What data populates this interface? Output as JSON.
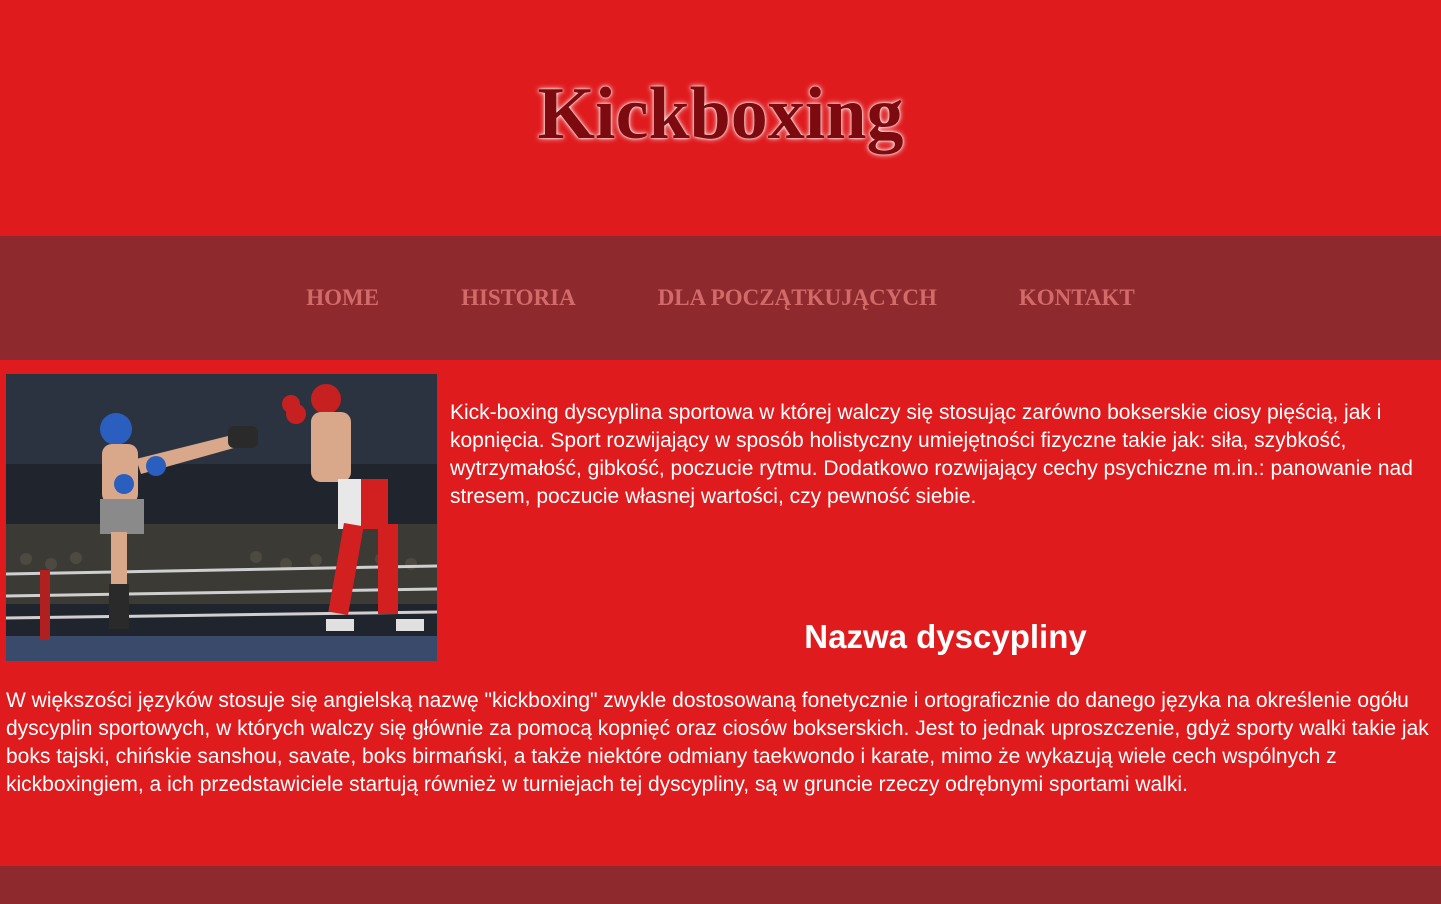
{
  "header": {
    "title": "Kickboxing"
  },
  "nav": {
    "items": [
      {
        "label": "HOME"
      },
      {
        "label": "HISTORIA"
      },
      {
        "label": "DLA POCZĄTKUJĄCYCH"
      },
      {
        "label": "KONTAKT"
      }
    ]
  },
  "main": {
    "intro": "Kick-boxing dyscyplina sportowa w której walczy się stosując zarówno bokserskie ciosy pięścią, jak i kopnięcia. Sport rozwijający w sposób holistyczny umiejętności fizyczne takie jak: siła, szybkość, wytrzymałość, gibkość, poczucie rytmu. Dodatkowo rozwijający cechy psychiczne m.in.: panowanie nad stresem, poczucie własnej wartości, czy pewność siebie.",
    "heading": "Nazwa dyscypliny",
    "body": "W większości języków stosuje się angielską nazwę \"kickboxing\" zwykle dostosowaną fonetycznie i ortograficznie do danego języka na określenie ogółu dyscyplin sportowych, w których walczy się głównie za pomocą kopnięć oraz ciosów bokserskich. Jest to jednak uproszczenie, gdyż sporty walki takie jak boks tajski, chińskie sanshou, savate, boks birmański, a także niektóre odmiany taekwondo i karate, mimo że wykazują wiele cech wspólnych z kickboxingiem, a ich przedstawiciele startują również w turniejach tej dyscypliny, są w gruncie rzeczy odrębnymi sportami walki."
  },
  "colors": {
    "page_bg": "#e01b1e",
    "nav_bg": "#8e2a2d",
    "nav_text": "#d26a6a",
    "title_text": "#7d0a0f"
  }
}
